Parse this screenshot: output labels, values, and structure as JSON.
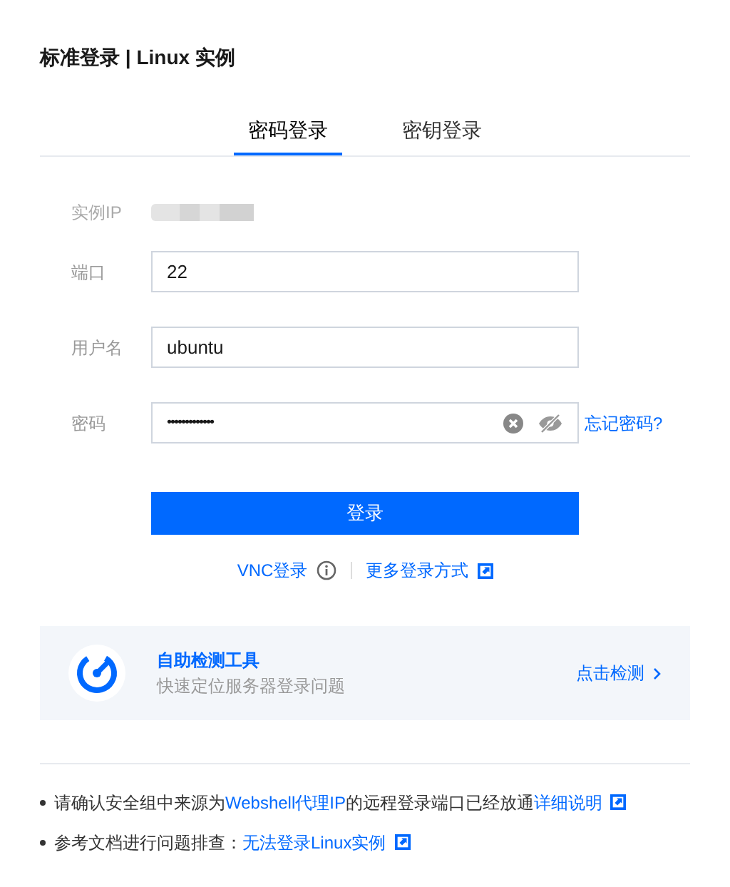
{
  "title": "标准登录 | Linux 实例",
  "tabs": [
    {
      "label": "密码登录",
      "selected": true
    },
    {
      "label": "密钥登录",
      "selected": false
    }
  ],
  "instance_ip": {
    "label": "实例IP"
  },
  "fields": [
    {
      "label": "端口",
      "value": "22",
      "kind": "text"
    },
    {
      "label": "用户名",
      "value": "ubuntu",
      "kind": "text"
    },
    {
      "label": "密码",
      "value": "•••••••••••••",
      "kind": "password",
      "link": "忘记密码?"
    }
  ],
  "login_button": "登录",
  "alt_links": {
    "vnc": "VNC登录",
    "more": "更多登录方式"
  },
  "tool_card": {
    "title": "自助检测工具",
    "subtitle": "快速定位服务器登录问题",
    "action": "点击检测"
  },
  "notes": [
    {
      "segments": [
        {
          "text": "请确认安全组中来源为",
          "link": false
        },
        {
          "text": "Webshell代理IP",
          "link": true
        },
        {
          "text": "的远程登录端口已经放通",
          "link": false
        },
        {
          "text": "详细说明",
          "link": true,
          "external": true
        }
      ]
    },
    {
      "segments": [
        {
          "text": "参考文档进行问题排查：",
          "link": false
        },
        {
          "text": "无法登录Linux实例",
          "link": true,
          "external": true
        }
      ]
    }
  ]
}
